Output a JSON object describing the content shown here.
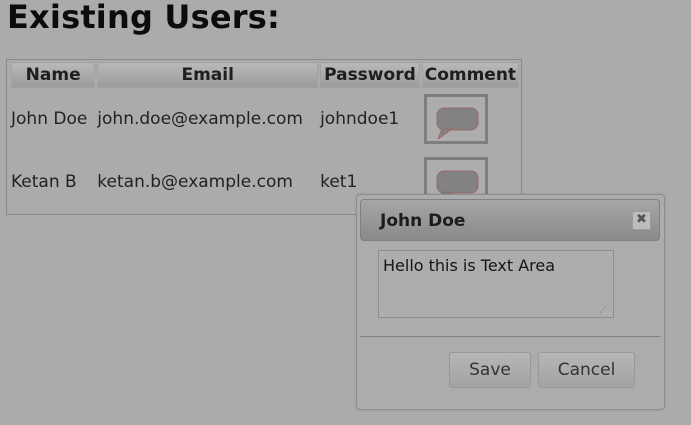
{
  "page": {
    "heading": "Existing Users:"
  },
  "users_table": {
    "columns": [
      "Name",
      "Email",
      "Password",
      "Comment"
    ],
    "rows": [
      {
        "name": "John Doe",
        "email": "john.doe@example.com",
        "password": "johndoe1"
      },
      {
        "name": "Ketan B",
        "email": "ketan.b@example.com",
        "password": "ket1"
      }
    ],
    "comment_icon": "speech-bubble-icon"
  },
  "dialog": {
    "title": "John Doe",
    "close_icon": "close-icon",
    "textarea_value": "Hello this is Text Area",
    "save_label": "Save",
    "cancel_label": "Cancel"
  }
}
